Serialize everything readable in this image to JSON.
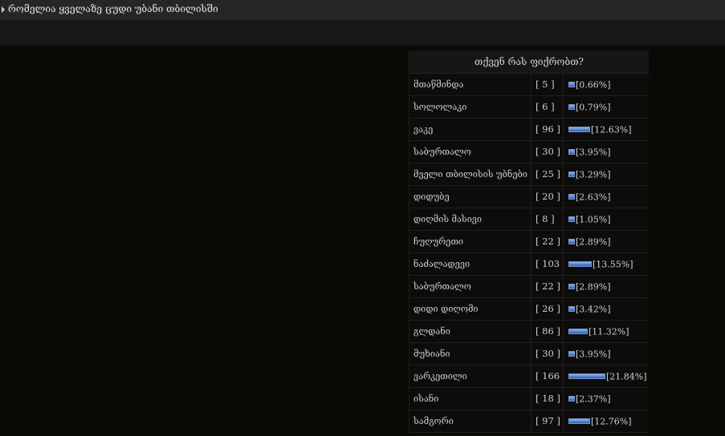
{
  "header": {
    "title": "რომელია ყველაზე ცუდი უბანი თბილისში"
  },
  "poll": {
    "question": "თქვენ რას ფიქრობთ?",
    "options": [
      {
        "name": "მთაწმინდა",
        "votes": "[ 5 ]",
        "percent_label": "[0.66%]",
        "percent": 0.66
      },
      {
        "name": "სოლოლაკი",
        "votes": "[ 6 ]",
        "percent_label": "[0.79%]",
        "percent": 0.79
      },
      {
        "name": "ვაკე",
        "votes": "[ 96 ]",
        "percent_label": "[12.63%]",
        "percent": 12.63
      },
      {
        "name": "საბურთალო",
        "votes": "[ 30 ]",
        "percent_label": "[3.95%]",
        "percent": 3.95
      },
      {
        "name": "მველი თბილისის უბნები",
        "votes": "[ 25 ]",
        "percent_label": "[3.29%]",
        "percent": 3.29
      },
      {
        "name": "დიდუბე",
        "votes": "[ 20 ]",
        "percent_label": "[2.63%]",
        "percent": 2.63
      },
      {
        "name": "დიღმის მასივი",
        "votes": "[ 8 ]",
        "percent_label": "[1.05%]",
        "percent": 1.05
      },
      {
        "name": "ჩუღურეთი",
        "votes": "[ 22 ]",
        "percent_label": "[2.89%]",
        "percent": 2.89
      },
      {
        "name": "ნაძალადევი",
        "votes": "[ 103 ]",
        "percent_label": "[13.55%]",
        "percent": 13.55
      },
      {
        "name": "საბურთალო",
        "votes": "[ 22 ]",
        "percent_label": "[2.89%]",
        "percent": 2.89
      },
      {
        "name": "დიდი დიღომი",
        "votes": "[ 26 ]",
        "percent_label": "[3.42%]",
        "percent": 3.42
      },
      {
        "name": "გლდანი",
        "votes": "[ 86 ]",
        "percent_label": "[11.32%]",
        "percent": 11.32
      },
      {
        "name": "მუხიანი",
        "votes": "[ 30 ]",
        "percent_label": "[3.95%]",
        "percent": 3.95
      },
      {
        "name": "ვარკეთილი",
        "votes": "[ 166 ]",
        "percent_label": "[21.84%]",
        "percent": 21.84
      },
      {
        "name": "ისანი",
        "votes": "[ 18 ]",
        "percent_label": "[2.37%]",
        "percent": 2.37
      },
      {
        "name": "სამგორი",
        "votes": "[ 97 ]",
        "percent_label": "[12.76%]",
        "percent": 12.76
      }
    ]
  },
  "colors": {
    "bar_fill": "#4f7ec8",
    "bar_border": "#6d95d6",
    "page_background": "#0b0906"
  }
}
